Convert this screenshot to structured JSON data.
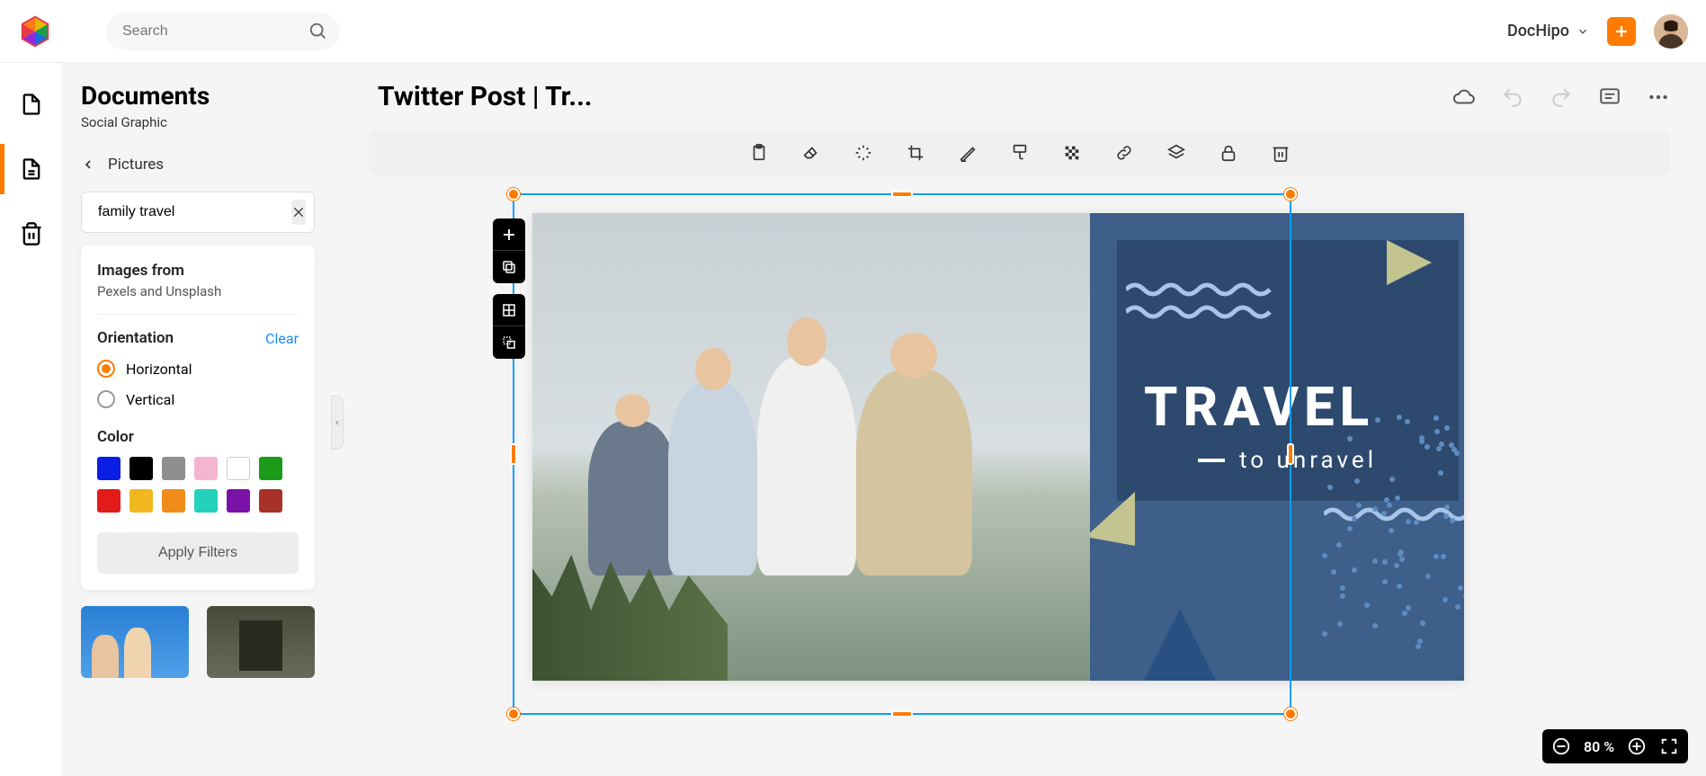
{
  "header": {
    "search_placeholder": "Search",
    "brand": "DocHipo"
  },
  "rail": {
    "items": [
      "document-icon",
      "page-icon",
      "trash-icon"
    ]
  },
  "sidebar": {
    "title": "Documents",
    "subtitle": "Social Graphic",
    "breadcrumb": "Pictures",
    "picture_search_value": "family travel",
    "images_from_label": "Images from",
    "images_from_value": "Pexels and Unsplash",
    "orientation_label": "Orientation",
    "clear_label": "Clear",
    "orientation_horizontal": "Horizontal",
    "orientation_vertical": "Vertical",
    "orientation_selected": "horizontal",
    "color_label": "Color",
    "colors": [
      "#0b1ee6",
      "#000000",
      "#8f8f8f",
      "#f4b6cf",
      "#ffffff",
      "#1a9b1a",
      "#e31b1b",
      "#f0b71f",
      "#f08c1a",
      "#23d1bd",
      "#7a12a8",
      "#a8322a"
    ],
    "apply_label": "Apply Filters"
  },
  "document": {
    "title": "Twitter Post | Tr...",
    "canvas_headline": "TRAVEL",
    "canvas_subtitle": "to unravel"
  },
  "zoom": {
    "value": "80 %"
  }
}
